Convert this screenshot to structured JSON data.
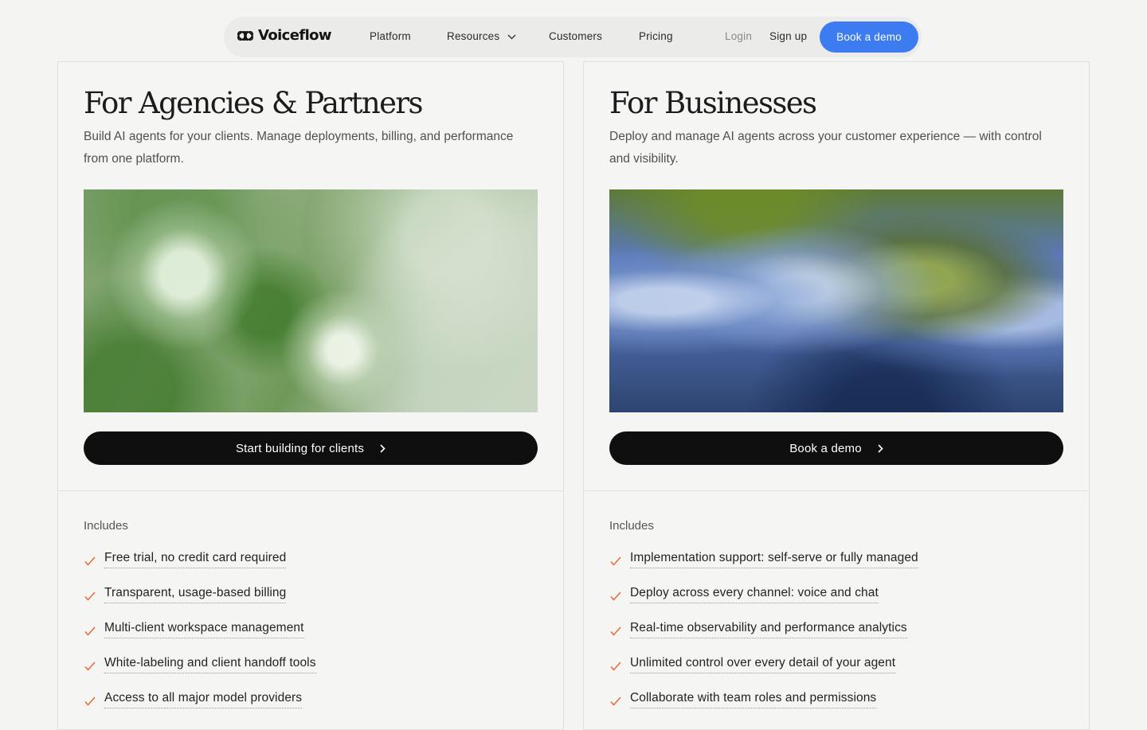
{
  "nav": {
    "logo_text": "Voiceflow",
    "links": {
      "platform": "Platform",
      "resources": "Resources",
      "customers": "Customers",
      "pricing": "Pricing",
      "login": "Login",
      "signup": "Sign up"
    },
    "demo_button": "Book a demo",
    "accent_color": "#3c7cf0"
  },
  "cards": [
    {
      "title": "For Agencies & Partners",
      "description": "Build AI agents for your clients. Manage deployments, billing, and performance from one platform.",
      "cta": "Start building for clients",
      "includes_label": "Includes",
      "features": [
        "Free trial, no credit card required",
        "Transparent, usage-based billing",
        "Multi-client workspace management",
        "White-labeling and client handoff tools",
        "Access to all major model providers"
      ]
    },
    {
      "title": "For Businesses",
      "description": "Deploy and manage AI agents across your customer experience — with control and visibility.",
      "cta": "Book a demo",
      "includes_label": "Includes",
      "features": [
        "Implementation support: self-serve or fully managed",
        "Deploy across every channel: voice and chat",
        "Real-time observability and performance analytics",
        "Unlimited control over every detail of your agent",
        "Collaborate with team roles and permissions"
      ]
    }
  ],
  "check_color": "#e8622c"
}
